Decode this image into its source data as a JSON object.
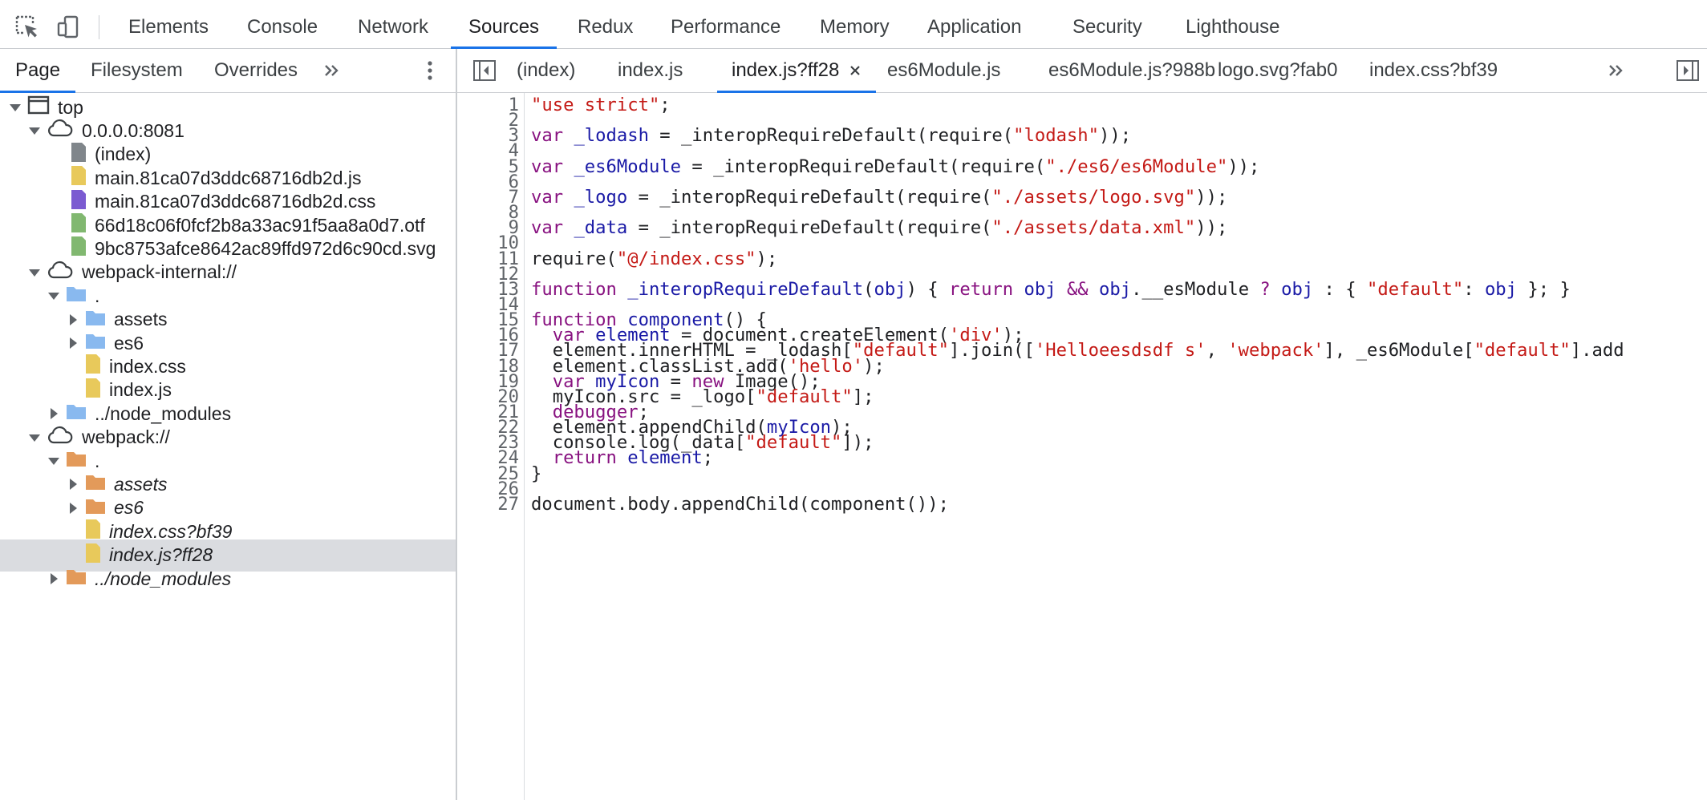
{
  "panel_tabs": [
    "Elements",
    "Console",
    "Network",
    "Sources",
    "Redux",
    "Performance",
    "Memory",
    "Application",
    "Security",
    "Lighthouse"
  ],
  "active_panel": "Sources",
  "nav_tabs": [
    "Page",
    "Filesystem",
    "Overrides"
  ],
  "active_nav_tab": "Page",
  "tree": [
    {
      "label": "top",
      "icon": "frame-icon",
      "expanded": true
    },
    {
      "label": "0.0.0.0:8081",
      "icon": "cloud-icon",
      "expanded": true
    },
    {
      "label": "(index)",
      "icon": "file-icon",
      "color": "#80868b"
    },
    {
      "label": "main.81ca07d3ddc68716db2d.js",
      "icon": "file-icon",
      "color": "#e8c95b"
    },
    {
      "label": "main.81ca07d3ddc68716db2d.css",
      "icon": "file-icon",
      "color": "#7b5bd1"
    },
    {
      "label": "66d18c06f0fcf2b8a33ac91f5aa8a0d7.otf",
      "icon": "file-icon",
      "color": "#81b870"
    },
    {
      "label": "9bc8753afce8642ac89ffd972d6c90cd.svg",
      "icon": "file-icon",
      "color": "#81b870"
    },
    {
      "label": "webpack-internal://",
      "icon": "cloud-icon",
      "expanded": true
    },
    {
      "label": ".",
      "icon": "folder-icon",
      "color": "#89b9ef",
      "expanded": true
    },
    {
      "label": "assets",
      "icon": "folder-icon",
      "color": "#89b9ef",
      "expanded": false
    },
    {
      "label": "es6",
      "icon": "folder-icon",
      "color": "#89b9ef",
      "expanded": false
    },
    {
      "label": "index.css",
      "icon": "file-icon",
      "color": "#e8c95b"
    },
    {
      "label": "index.js",
      "icon": "file-icon",
      "color": "#e8c95b"
    },
    {
      "label": "../node_modules",
      "icon": "folder-icon",
      "color": "#89b9ef",
      "expanded": false
    },
    {
      "label": "webpack://",
      "icon": "cloud-icon",
      "expanded": true
    },
    {
      "label": ".",
      "icon": "folder-icon",
      "color": "#e39a5a",
      "expanded": true
    },
    {
      "label": "assets",
      "icon": "folder-icon",
      "color": "#e39a5a",
      "expanded": false,
      "italic": true
    },
    {
      "label": "es6",
      "icon": "folder-icon",
      "color": "#e39a5a",
      "expanded": false,
      "italic": true
    },
    {
      "label": "index.css?bf39",
      "icon": "file-icon",
      "color": "#e8c95b",
      "italic": true
    },
    {
      "label": "index.js?ff28",
      "icon": "file-icon",
      "color": "#e8c95b",
      "italic": true,
      "selected": true
    },
    {
      "label": "../node_modules",
      "icon": "folder-icon",
      "color": "#e39a5a",
      "expanded": false,
      "italic": true
    }
  ],
  "editor_tabs": [
    "(index)",
    "index.js",
    "index.js?ff28",
    "es6Module.js",
    "es6Module.js?988b",
    "logo.svg?fab0",
    "index.css?bf39"
  ],
  "active_editor_tab": "index.js?ff28",
  "code_lines": [
    "\"use strict\";",
    "",
    "var _lodash = _interopRequireDefault(require(\"lodash\"));",
    "",
    "var _es6Module = _interopRequireDefault(require(\"./es6/es6Module\"));",
    "",
    "var _logo = _interopRequireDefault(require(\"./assets/logo.svg\"));",
    "",
    "var _data = _interopRequireDefault(require(\"./assets/data.xml\"));",
    "",
    "require(\"@/index.css\");",
    "",
    "function _interopRequireDefault(obj) { return obj && obj.__esModule ? obj : { \"default\": obj }; }",
    "",
    "function component() {",
    "  var element = document.createElement('div');",
    "  element.innerHTML = _lodash[\"default\"].join(['Helloeesdsdf s', 'webpack'], _es6Module[\"default\"].add",
    "  element.classList.add('hello');",
    "  var myIcon = new Image();",
    "  myIcon.src = _logo[\"default\"];",
    "  debugger;",
    "  element.appendChild(myIcon);",
    "  console.log(_data[\"default\"]);",
    "  return element;",
    "}",
    "",
    "document.body.appendChild(component());"
  ]
}
